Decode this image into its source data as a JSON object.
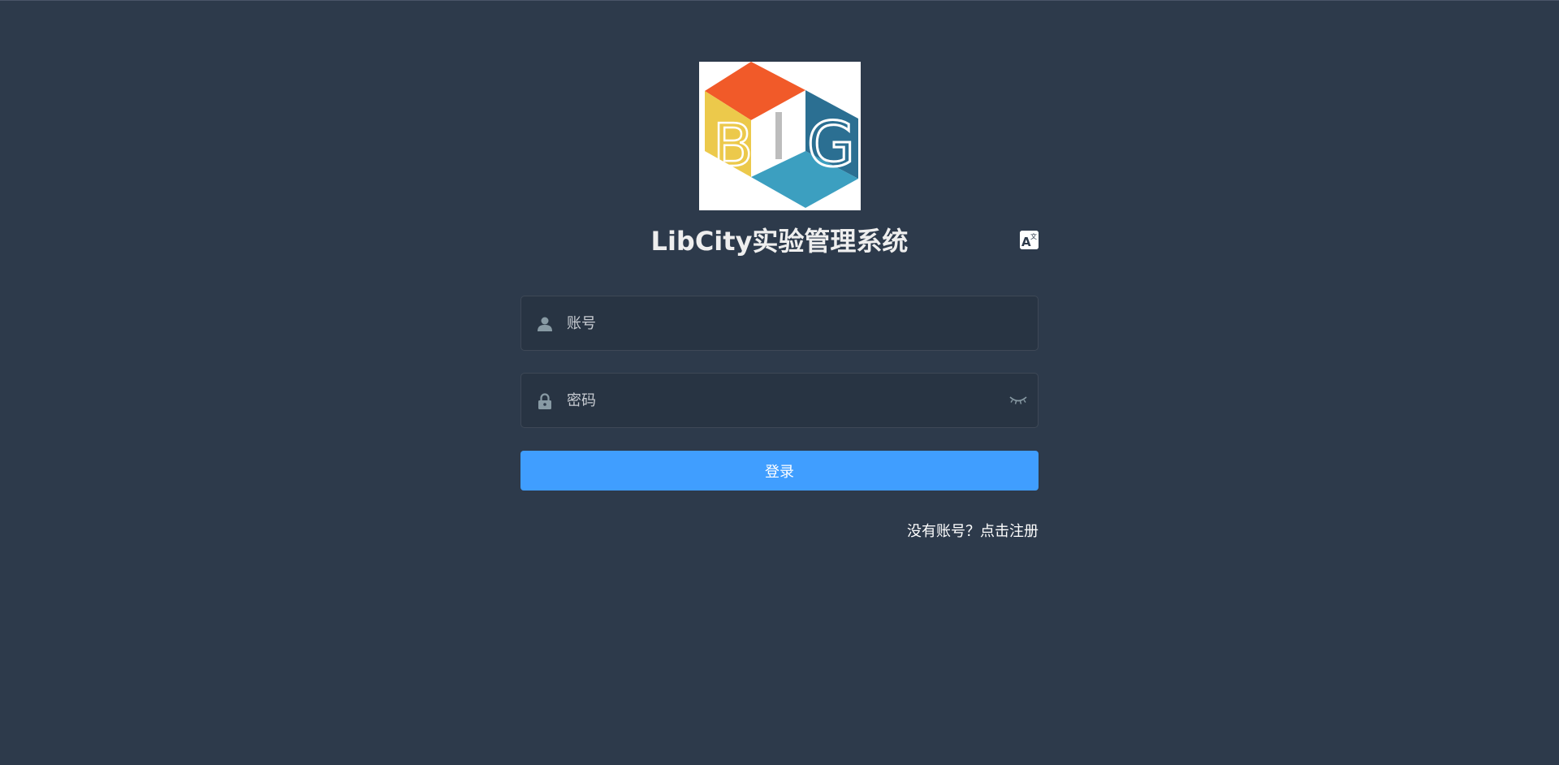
{
  "app": {
    "title": "LibCity实验管理系统"
  },
  "logo": {
    "letters": [
      "B",
      "I",
      "G"
    ],
    "colors": {
      "top": "#f15a29",
      "left": "#ecc94b",
      "right": "#2b6f92",
      "bottom": "#3c9fc0"
    }
  },
  "header": {
    "language_icon": "translate-icon"
  },
  "form": {
    "username": {
      "placeholder": "账号",
      "value": "",
      "icon": "user-icon"
    },
    "password": {
      "placeholder": "密码",
      "value": "",
      "icon": "lock-icon",
      "toggle_icon": "eye-closed-icon"
    },
    "login_label": "登录",
    "register_text": "没有账号？点击注册"
  },
  "colors": {
    "background": "#2d3a4b",
    "primary": "#409eff",
    "title": "#eeeeee",
    "icon": "#889aa4"
  }
}
